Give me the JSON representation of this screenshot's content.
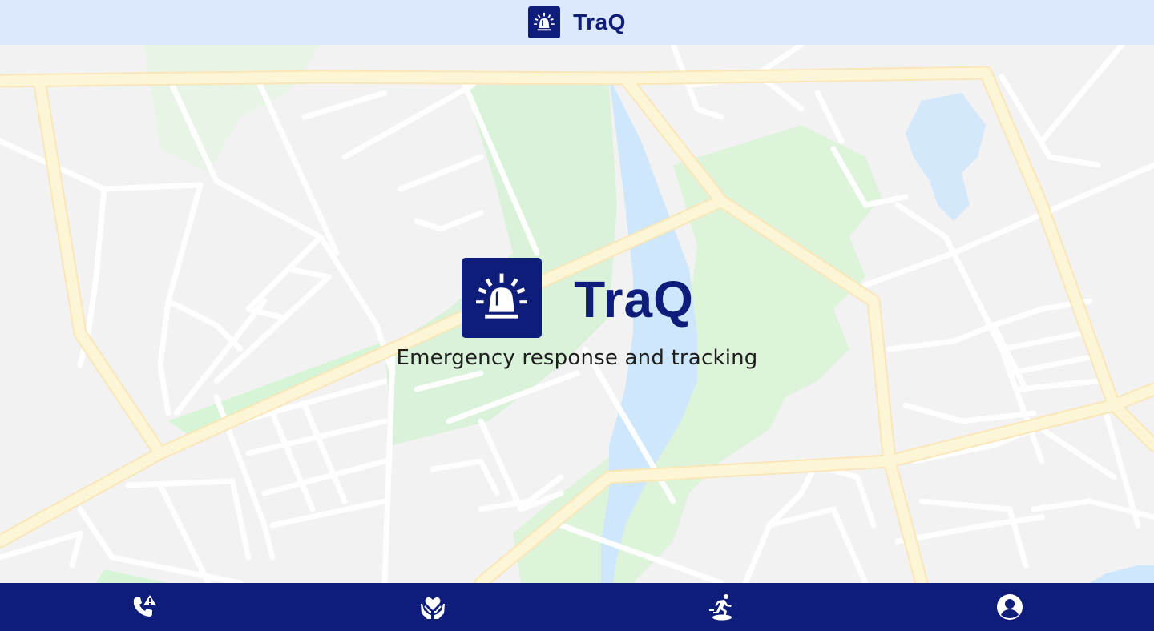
{
  "header": {
    "app_name": "TraQ",
    "logo_icon": "siren-icon"
  },
  "splash": {
    "app_name": "TraQ",
    "tagline": "Emergency response and tracking",
    "logo_icon": "siren-icon"
  },
  "map": {
    "background_color": "#eeeeee",
    "road_color": "#fdf2c4",
    "park_color": "#c9f0c9",
    "water_color": "#bfdffb"
  },
  "bottom_nav": {
    "items": [
      {
        "icon": "emergency-call-icon"
      },
      {
        "icon": "care-hands-heart-icon"
      },
      {
        "icon": "evacuation-runner-icon"
      },
      {
        "icon": "account-icon"
      }
    ]
  },
  "colors": {
    "brand": "#0f1d7a",
    "header_bg": "#dce8fe",
    "nav_bg": "#0f1d7a"
  }
}
